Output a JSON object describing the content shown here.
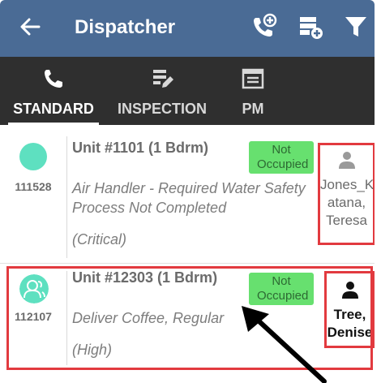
{
  "header": {
    "title": "Dispatcher",
    "icons": [
      "back-arrow-icon",
      "add-call-icon",
      "add-list-icon",
      "filter-icon"
    ],
    "bar_color": "#4a6b95"
  },
  "tabs": [
    {
      "label": "STANDARD",
      "icon": "phone-icon",
      "active": true
    },
    {
      "label": "INSPECTION",
      "icon": "checklist-edit-icon",
      "active": false
    },
    {
      "label": "PM",
      "icon": "calendar-list-icon",
      "active": false
    }
  ],
  "work_orders": [
    {
      "id": "111528",
      "unit": "Unit #1101 (1 Bdrm)",
      "status": "Not Occupied",
      "description": "Air Handler - Required Water Safety Process Not Completed",
      "priority": "(Critical)",
      "assignee": "Jones_Katana, Teresa",
      "assignee_lines": [
        "Jones_K",
        "atana,",
        "Teresa"
      ],
      "avatar_color": "#5ee0c0"
    },
    {
      "id": "112107",
      "unit": "Unit #12303 (1 Bdrm)",
      "status": "Not Occupied",
      "description": "Deliver Coffee, Regular",
      "priority": "(High)",
      "assignee": "Tree, Denise",
      "assignee_lines": [
        "Tree,",
        "Denise"
      ],
      "avatar_color": "#5ee0c0"
    }
  ],
  "colors": {
    "highlight": "#e23a3f",
    "status_badge": "#67e06f",
    "tab_bar": "#2f2f2f"
  }
}
